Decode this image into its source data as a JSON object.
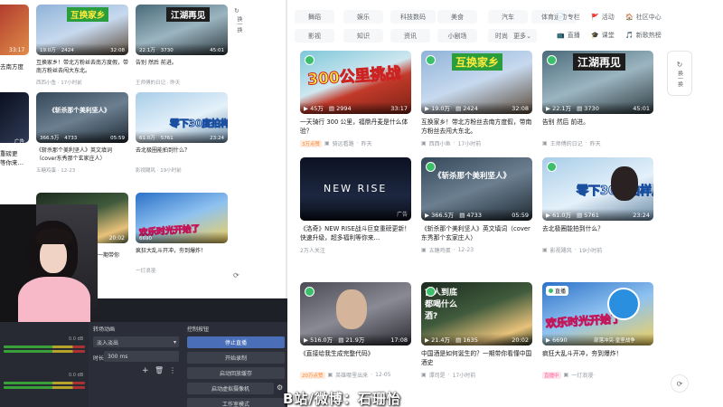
{
  "nav": {
    "categories_row1": [
      "舞蹈",
      "娱乐",
      "科技数码",
      "美食",
      "汽车",
      "体育运动"
    ],
    "categories_row2": [
      "影视",
      "知识",
      "资讯",
      "小剧场",
      "时尚美妆"
    ],
    "more": "更多",
    "side_row1": [
      "专栏",
      "活动",
      "社区中心"
    ],
    "side_row2": [
      "直播",
      "课堂",
      "新歌热榜"
    ]
  },
  "float_buttons": {
    "refresh": "换一换"
  },
  "main_videos": [
    {
      "overlay": "300公里挑战",
      "views": "45万",
      "comments": "2994",
      "duration": "33:17",
      "title": "一天骑行 300 公里，福鼎丹麦是什么体验？",
      "badge": "3万点赞",
      "author": "骑远看路",
      "date": "昨天"
    },
    {
      "overlay": "互换家乡",
      "views": "19.0万",
      "comments": "2424",
      "duration": "32:08",
      "title": "互换家乡！带北方粉丝去南方度假，带南方粉丝去闯大东北。",
      "badge": "",
      "author": "西西小鱼",
      "date": "17小时前"
    },
    {
      "overlay": "江湖再见",
      "views": "22.1万",
      "comments": "3730",
      "duration": "45:01",
      "title": "告别 然后 前进。",
      "badge": "",
      "author": "王师傅的日记",
      "date": "昨天"
    },
    {
      "overlay": "NEW RISE",
      "views": "",
      "comments": "",
      "duration": "",
      "title": "《洛奇》NEW RISE战斗巨变重磅更新！快速升级，超多福利等你来…",
      "badge": "",
      "author": "2万人关注",
      "date": "",
      "ad": "广告"
    },
    {
      "overlay": "《斩杀那个美利坚人》",
      "views": "366.5万",
      "comments": "4733",
      "duration": "05:59",
      "title": "《斩杀那个美利坚人》英文填词（cover东秀那个玄家庄人）",
      "badge": "",
      "author": "五糖鸡蛋",
      "date": "12-23"
    },
    {
      "overlay": "零下30度拍样片",
      "views": "61.0万",
      "comments": "5761",
      "duration": "23:24",
      "title": "去北极圈能拍到什么？",
      "badge": "",
      "author": "影视飓风",
      "date": "19小时前"
    },
    {
      "overlay": "",
      "views": "516.0万",
      "comments": "21.9万",
      "duration": "17:08",
      "title": "《直接给我生成完整代码》",
      "badge": "20万点赞",
      "author": "英雄哪里出来",
      "date": "12-05"
    },
    {
      "overlay": "古人到底都喝什么酒?",
      "views": "21.4万",
      "comments": "1635",
      "duration": "20:02",
      "title": "中国酒是如何诞生的？一期带你看懂中国酒史",
      "badge": "",
      "author": "谭司是",
      "date": "17小时前"
    },
    {
      "overlay": "欢乐时光开始了",
      "views": "6690",
      "comments": "",
      "duration": "",
      "title": "疯狂大乱斗开冲，夯到爆炸！",
      "badge": "直播中",
      "author": "一灯浪漫·",
      "date": "",
      "live": "直播",
      "sub": "部落冲突·皇室战争"
    }
  ],
  "obs_inner_videos": [
    {
      "overlay": "",
      "views": "",
      "comments": "",
      "duration": "33:17",
      "title": "",
      "meta": ""
    },
    {
      "overlay": "互换家乡",
      "views": "19.0万",
      "comments": "2424",
      "duration": "32:08",
      "title": "互换家乡！带北方粉丝去南方度假，带南方粉丝去闯大东北。",
      "meta": "西西小鱼 · 17小时前"
    },
    {
      "overlay": "江湖再见",
      "views": "22.1万",
      "comments": "3730",
      "duration": "45:01",
      "title": "告别 然后 前进。",
      "meta": "王师傅的日记 · 昨天"
    },
    {
      "overlay": "《斩杀那个美利坚人》",
      "views": "366.5万",
      "comments": "4733",
      "duration": "05:59",
      "title": "《斩杀那个美利坚人》英文填词（cover东秀那个玄家庄人）",
      "meta": "五糖鸡蛋 · 12-23"
    },
    {
      "overlay": "零下30度拍样片",
      "views": "61.0万",
      "comments": "5761",
      "duration": "23:24",
      "title": "去北极圈能拍到什么？",
      "meta": "影视飓风 · 19小时前"
    },
    {
      "overlay": "欢乐时光开始了",
      "views": "6690",
      "comments": "",
      "duration": "",
      "title": "疯狂大乱斗开冲，夯到爆炸！",
      "meta": "一灯浪漫·"
    }
  ],
  "obs_inner_left": {
    "text1": "去南方度",
    "text2": "重磅更",
    "text3": "等你来…",
    "tag": "广告",
    "bottom_duration": "20:02",
    "bottom_title": "一期带你",
    "bottom_meta": "小时前"
  },
  "obs": {
    "mixer_label": "",
    "transitions_header": "转场动画",
    "transition_value": "淡入淡出",
    "duration_label": "时长",
    "duration_value": "300 ms",
    "controls_header": "控制按钮",
    "buttons": [
      "停止直播",
      "开始录制",
      "启动回放缓存",
      "启动虚拟摄像机",
      "工作室模式"
    ],
    "db_values": [
      "0.0 dB",
      "0.0 dB"
    ]
  },
  "watermark": "B站/微博：石珊怡",
  "colors": {
    "accent": "#00aeec",
    "badge": "#ff7f24",
    "live": "#ff6699"
  }
}
